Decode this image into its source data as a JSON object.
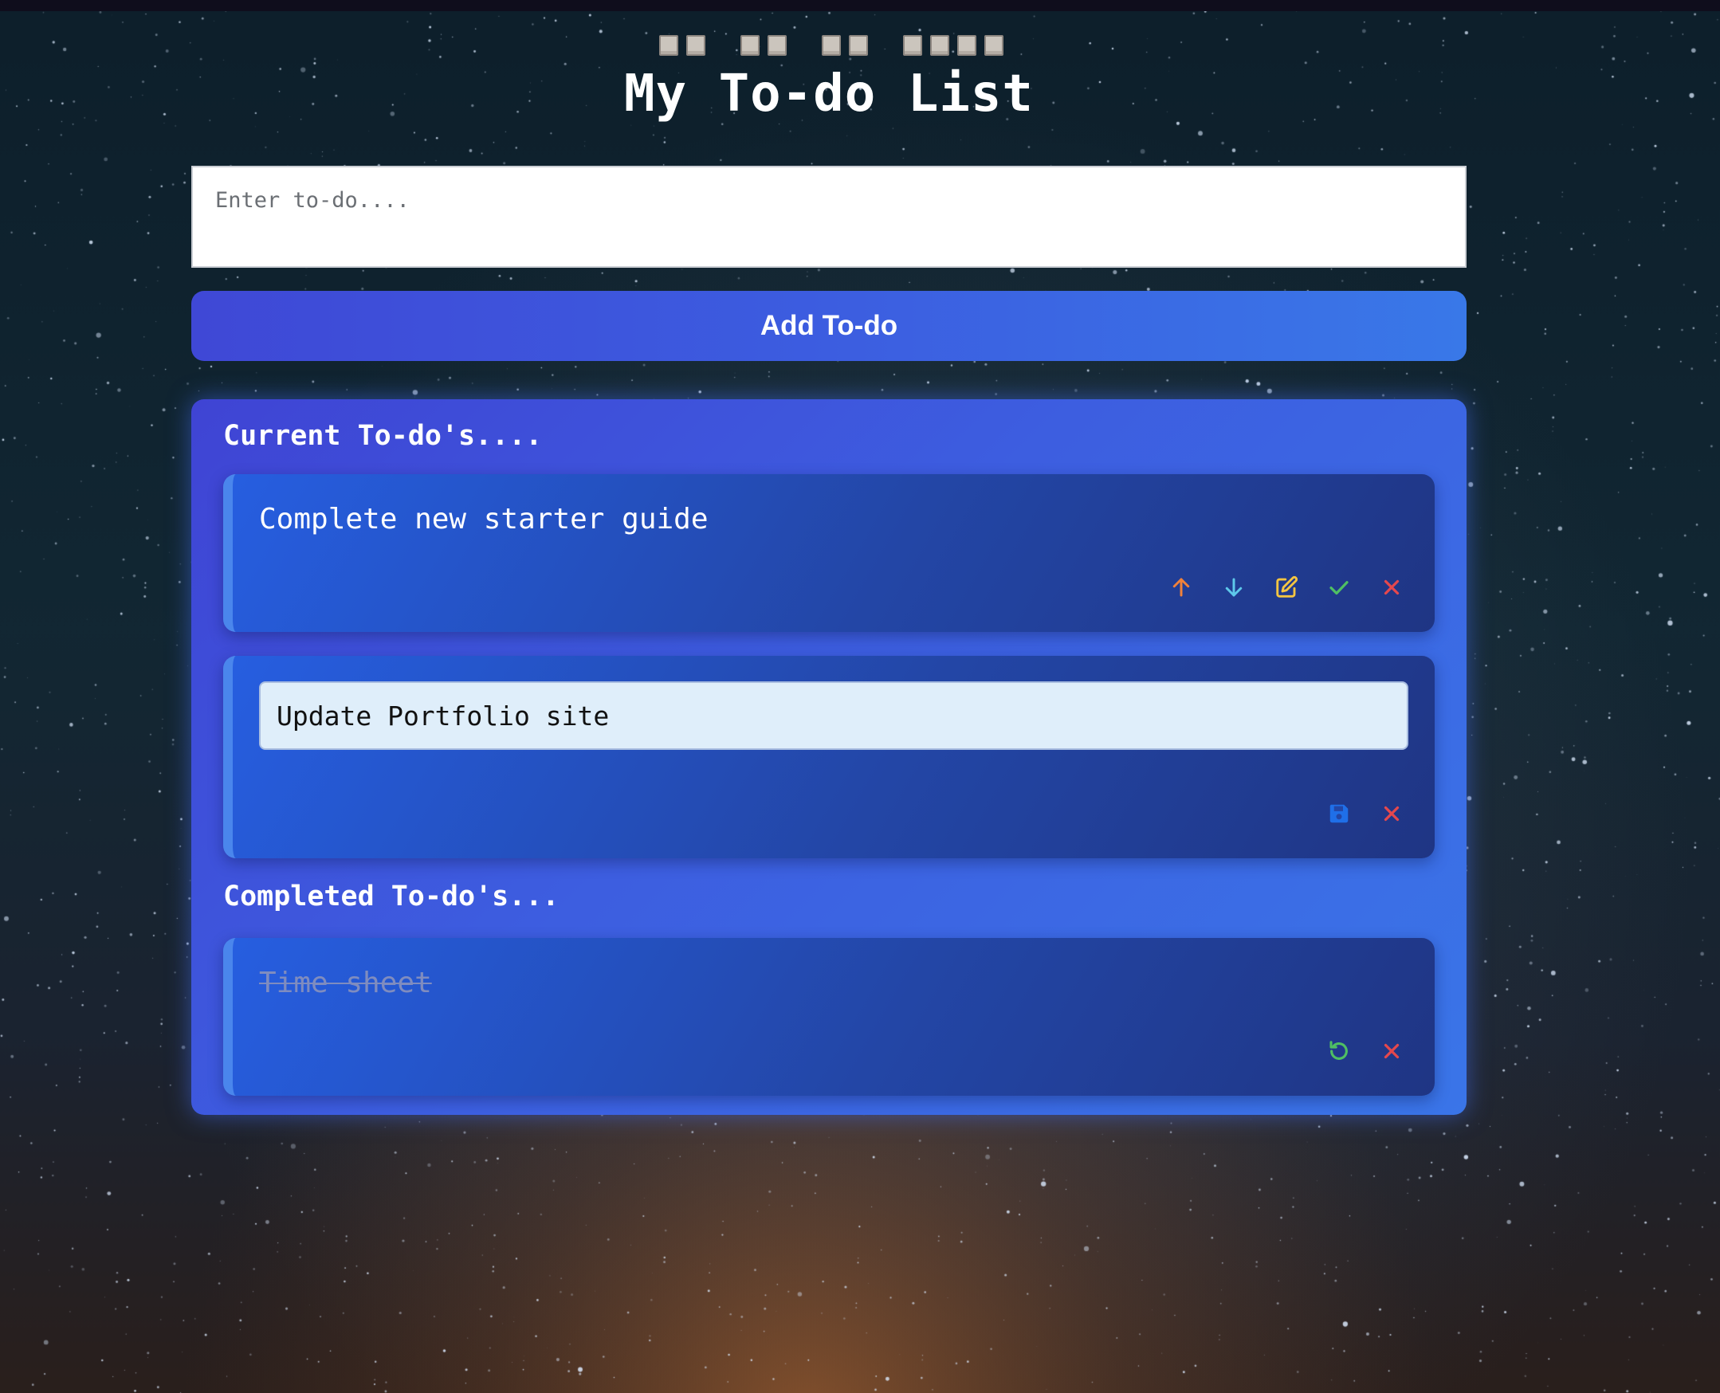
{
  "header": {
    "glyph_groups": [
      2,
      2,
      2,
      4
    ],
    "title": "My To-do List"
  },
  "input": {
    "placeholder": "Enter to-do....",
    "value": ""
  },
  "add_button": {
    "label": "Add To-do"
  },
  "sections": {
    "current_title": "Current To-do's....",
    "completed_title": "Completed To-do's..."
  },
  "current_todos": [
    {
      "text": "Complete new starter guide",
      "mode": "view",
      "actions": [
        "arrow-up-icon",
        "arrow-down-icon",
        "edit-icon",
        "check-icon",
        "close-icon"
      ]
    },
    {
      "text": "Update Portfolio site",
      "mode": "edit",
      "actions": [
        "save-icon",
        "close-icon"
      ]
    }
  ],
  "completed_todos": [
    {
      "text": "Time sheet",
      "actions": [
        "undo-icon",
        "close-icon"
      ]
    }
  ],
  "colors": {
    "arrow_up": "#f0813a",
    "arrow_down": "#5ec8ea",
    "edit": "#f4c542",
    "check": "#4fbf63",
    "close": "#e5484d",
    "save": "#1f6fe8",
    "undo": "#4fbf63",
    "panel_from": "#3f44d4",
    "panel_to": "#3a75e8"
  }
}
